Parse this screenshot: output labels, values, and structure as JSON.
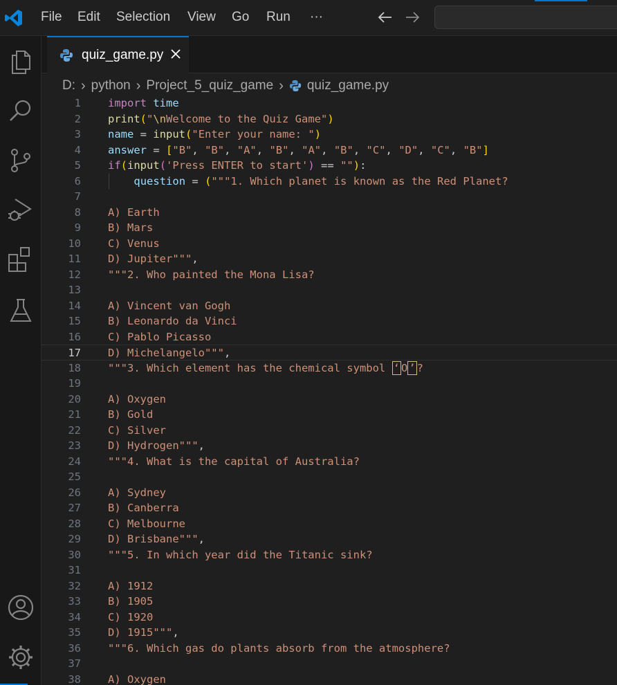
{
  "menu": [
    "File",
    "Edit",
    "Selection",
    "View",
    "Go",
    "Run",
    "···"
  ],
  "tab": {
    "label": "quiz_game.py",
    "close_icon": "close-icon"
  },
  "breadcrumb": [
    "D:",
    "python",
    "Project_5_quiz_game",
    "quiz_game.py"
  ],
  "activity_icons": [
    "explorer-icon",
    "search-icon",
    "source-control-icon",
    "run-debug-icon",
    "extensions-icon",
    "testing-icon",
    "account-icon",
    "settings-gear-icon"
  ],
  "editor": {
    "active_line": 17,
    "lines": [
      {
        "n": "1",
        "t": "import time"
      },
      {
        "n": "2",
        "t": "print(\"\\nWelcome to the Quiz Game\")"
      },
      {
        "n": "3",
        "t": "name = input(\"Enter your name: \")"
      },
      {
        "n": "4",
        "t": "answer = [\"B\", \"B\", \"A\", \"B\", \"A\", \"B\", \"C\", \"D\", \"C\", \"B\"]"
      },
      {
        "n": "5",
        "t": "if(input('Press ENTER to start') == \"\"):"
      },
      {
        "n": "6",
        "t": "    question = (\"\"\"1. Which planet is known as the Red Planet?"
      },
      {
        "n": "7",
        "t": ""
      },
      {
        "n": "8",
        "t": "A) Earth"
      },
      {
        "n": "9",
        "t": "B) Mars"
      },
      {
        "n": "10",
        "t": "C) Venus"
      },
      {
        "n": "11",
        "t": "D) Jupiter\"\"\","
      },
      {
        "n": "12",
        "t": "\"\"\"2. Who painted the Mona Lisa?"
      },
      {
        "n": "13",
        "t": ""
      },
      {
        "n": "14",
        "t": "A) Vincent van Gogh"
      },
      {
        "n": "15",
        "t": "B) Leonardo da Vinci"
      },
      {
        "n": "16",
        "t": "C) Pablo Picasso"
      },
      {
        "n": "17",
        "t": "D) Michelangelo\"\"\","
      },
      {
        "n": "18",
        "t": "\"\"\"3. Which element has the chemical symbol ‘O’?"
      },
      {
        "n": "19",
        "t": ""
      },
      {
        "n": "20",
        "t": "A) Oxygen"
      },
      {
        "n": "21",
        "t": "B) Gold"
      },
      {
        "n": "22",
        "t": "C) Silver"
      },
      {
        "n": "23",
        "t": "D) Hydrogen\"\"\","
      },
      {
        "n": "24",
        "t": "\"\"\"4. What is the capital of Australia?"
      },
      {
        "n": "25",
        "t": ""
      },
      {
        "n": "26",
        "t": "A) Sydney"
      },
      {
        "n": "27",
        "t": "B) Canberra"
      },
      {
        "n": "28",
        "t": "C) Melbourne"
      },
      {
        "n": "29",
        "t": "D) Brisbane\"\"\","
      },
      {
        "n": "30",
        "t": "\"\"\"5. In which year did the Titanic sink?"
      },
      {
        "n": "31",
        "t": ""
      },
      {
        "n": "32",
        "t": "A) 1912"
      },
      {
        "n": "33",
        "t": "B) 1905"
      },
      {
        "n": "34",
        "t": "C) 1920"
      },
      {
        "n": "35",
        "t": "D) 1915\"\"\","
      },
      {
        "n": "36",
        "t": "\"\"\"6. Which gas do plants absorb from the atmosphere?"
      },
      {
        "n": "37",
        "t": ""
      },
      {
        "n": "38",
        "t": "A) Oxygen"
      }
    ]
  },
  "colors": {
    "accent": "#0078d4",
    "editor_bg": "#1f1f1f",
    "string": "#ce9178",
    "keyword": "#c586c0",
    "function": "#dcdcaa",
    "variable": "#9cdcfe"
  }
}
